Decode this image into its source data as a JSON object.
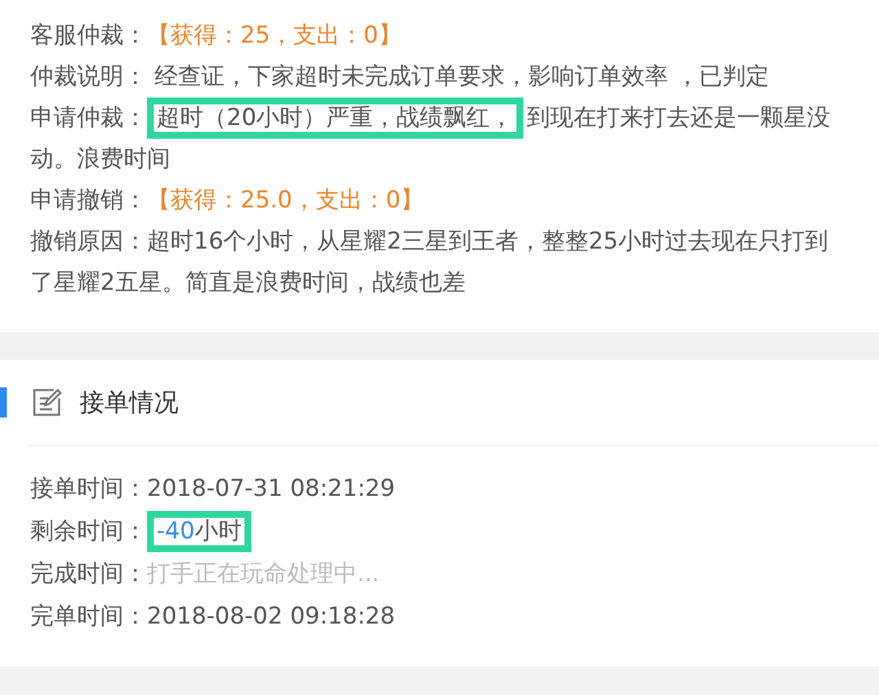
{
  "arbitration": {
    "rows": [
      {
        "label": "客服仲裁：",
        "parts": [
          {
            "text": "【获得：25，支出：0】",
            "kind": "amount",
            "highlighted": false
          }
        ]
      },
      {
        "label": "仲裁说明：",
        "parts": [
          {
            "text": " 经查证，下家超时未完成订单要求，影响订单效率 ，已判定",
            "kind": "plain",
            "highlighted": false
          }
        ]
      },
      {
        "label": "申请仲裁：",
        "parts": [
          {
            "text": "超时（20小时）严重，战绩飘红，",
            "kind": "plain",
            "highlighted": true
          },
          {
            "text": "到现在打来打去还是一颗星没动。浪费时间",
            "kind": "plain",
            "highlighted": false
          }
        ]
      },
      {
        "label": "申请撤销：",
        "parts": [
          {
            "text": "【获得：25.0，支出：0】",
            "kind": "amount",
            "highlighted": false
          }
        ]
      },
      {
        "label": "撤销原因：",
        "parts": [
          {
            "text": "超时16个小时，从星耀2三星到王者，整整25小时过去现在只打到了星耀2五星。简直是浪费时间，战绩也差",
            "kind": "plain",
            "highlighted": false
          }
        ]
      }
    ]
  },
  "order_section": {
    "title": "接单情况",
    "rows": [
      {
        "label": "接单时间：",
        "parts": [
          {
            "text": "2018-07-31 08:21:29",
            "kind": "plain",
            "highlighted": false
          }
        ]
      },
      {
        "label": "剩余时间：",
        "parts": [
          {
            "text": "-40",
            "kind": "number",
            "highlighted": true
          },
          {
            "text": "小时",
            "kind": "plain",
            "highlighted": true
          }
        ]
      },
      {
        "label": "完成时间：",
        "parts": [
          {
            "text": "打手正在玩命处理中...",
            "kind": "muted",
            "highlighted": false
          }
        ]
      },
      {
        "label": "完单时间：",
        "parts": [
          {
            "text": "2018-08-02 09:18:28",
            "kind": "plain",
            "highlighted": false
          }
        ]
      }
    ]
  }
}
